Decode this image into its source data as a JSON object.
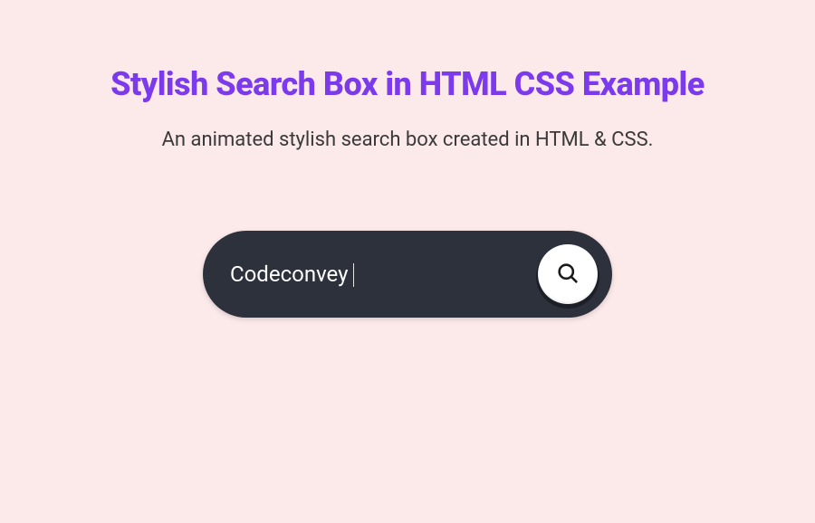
{
  "header": {
    "title": "Stylish Search Box in HTML CSS Example",
    "subtitle": "An animated stylish search box created in HTML & CSS."
  },
  "search": {
    "value": "Codeconvey",
    "placeholder": "",
    "icon": "search-icon"
  }
}
